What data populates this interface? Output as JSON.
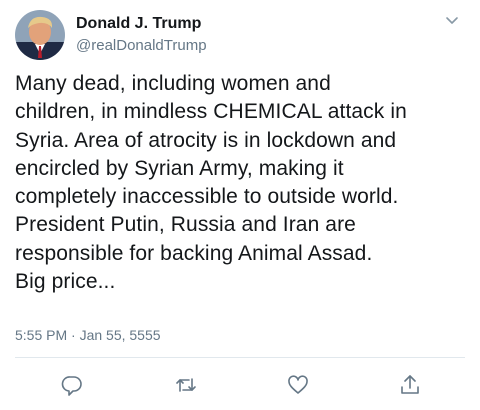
{
  "author": {
    "display_name": "Donald J. Trump",
    "handle": "@realDonaldTrump"
  },
  "tweet": {
    "lines": [
      "Many dead, including women and",
      "children, in mindless CHEMICAL attack in",
      "Syria. Area of atrocity is in lockdown and",
      "encircled by Syrian Army, making it",
      "completely inaccessible to outside world.",
      "President Putin, Russia and Iran are",
      "responsible for backing Animal Assad.",
      "Big price..."
    ],
    "timestamp": "5:55 PM · Jan 55, 5555"
  },
  "icons": {
    "menu": "chevron-down-icon",
    "reply": "reply-icon",
    "retweet": "retweet-icon",
    "like": "heart-icon",
    "share": "share-icon"
  },
  "colors": {
    "text": "#14171a",
    "secondary": "#657786",
    "icon": "#657786",
    "divider": "#e1e8ed"
  }
}
